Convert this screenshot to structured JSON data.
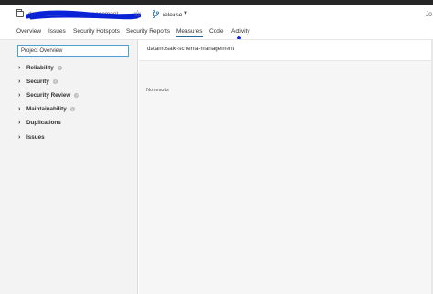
{
  "header": {
    "project_name": "datamosaix-schema-management",
    "branch": {
      "name": "release",
      "icon": "branch-icon"
    },
    "favorite_icon": "star-icon",
    "user_truncated": "Jo"
  },
  "nav": {
    "tabs": [
      {
        "label": "Overview"
      },
      {
        "label": "Issues"
      },
      {
        "label": "Security Hotspots"
      },
      {
        "label": "Security Reports"
      },
      {
        "label": "Measures",
        "active": true
      },
      {
        "label": "Code"
      },
      {
        "label": "Activity"
      }
    ]
  },
  "sidebar": {
    "overview_button": "Project Overview",
    "items": [
      {
        "label": "Reliability",
        "help": true
      },
      {
        "label": "Security",
        "help": true
      },
      {
        "label": "Security Review",
        "help": true
      },
      {
        "label": "Maintainability",
        "help": true
      },
      {
        "label": "Duplications",
        "help": false
      },
      {
        "label": "Issues",
        "help": false
      }
    ]
  },
  "main": {
    "component_name": "datamosaix-schema-management",
    "empty_message": "No results"
  },
  "colors": {
    "accent": "#236a97",
    "selected_border": "#4b9fd5",
    "annotation_dot": "#0a23d6",
    "redaction": "#0a23d6"
  }
}
